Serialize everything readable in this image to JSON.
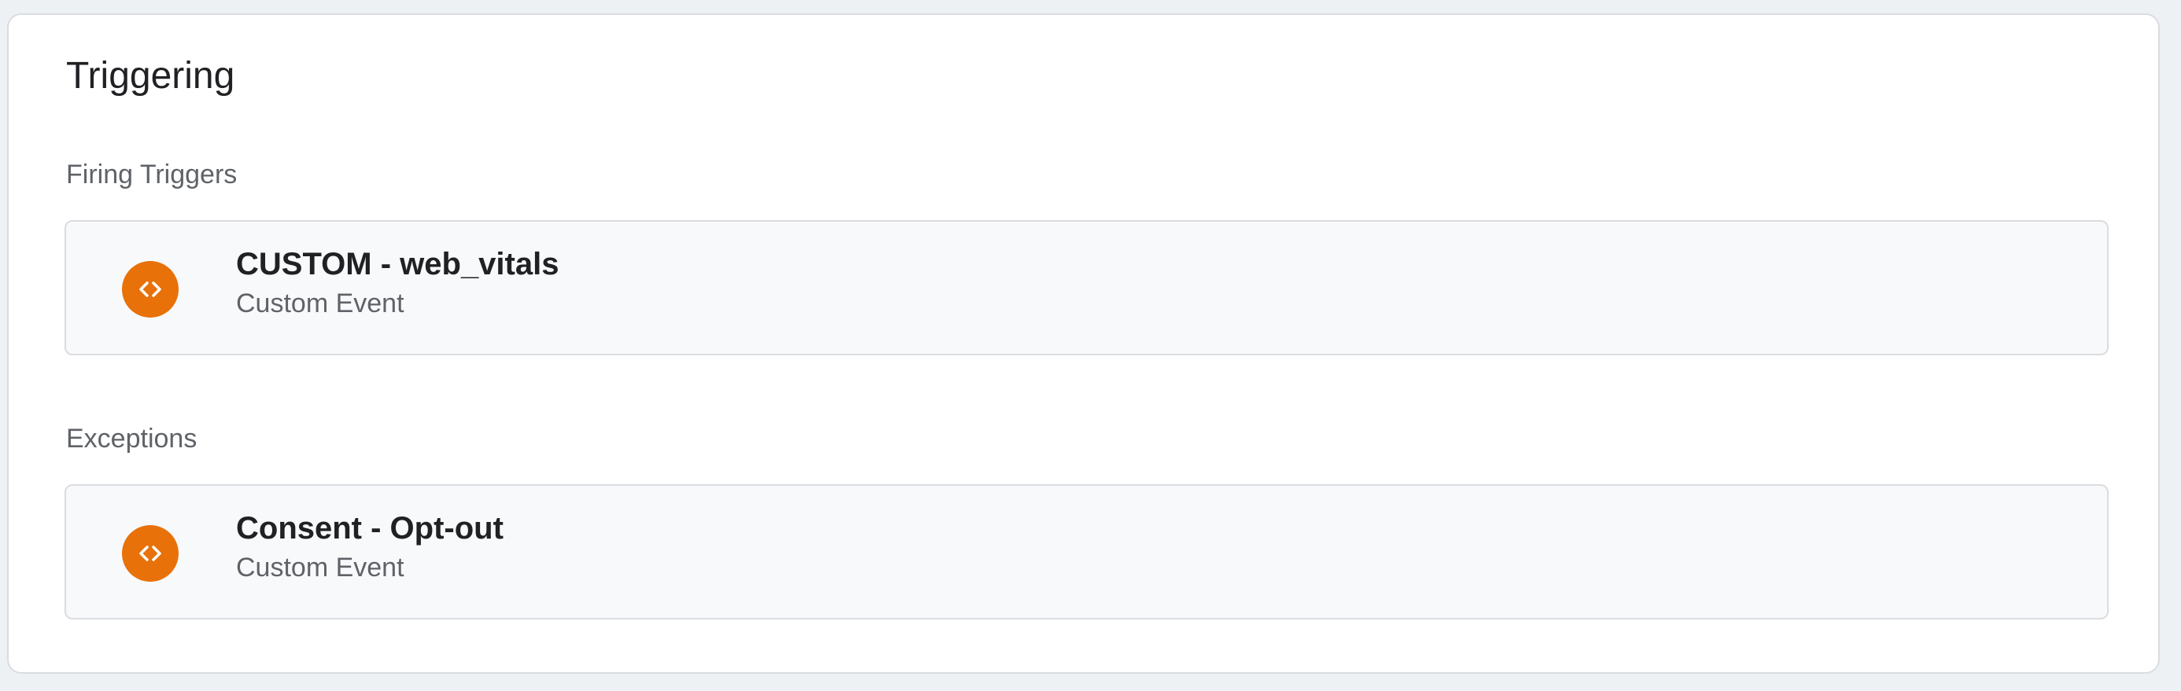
{
  "card": {
    "title": "Triggering"
  },
  "firing": {
    "label": "Firing Triggers",
    "items": [
      {
        "name": "CUSTOM - web_vitals",
        "type": "Custom Event",
        "icon": "custom-event-code-icon",
        "color": "#e8710a"
      }
    ]
  },
  "exceptions": {
    "label": "Exceptions",
    "items": [
      {
        "name": "Consent - Opt-out",
        "type": "Custom Event",
        "icon": "custom-event-code-icon",
        "color": "#e8710a"
      }
    ]
  }
}
